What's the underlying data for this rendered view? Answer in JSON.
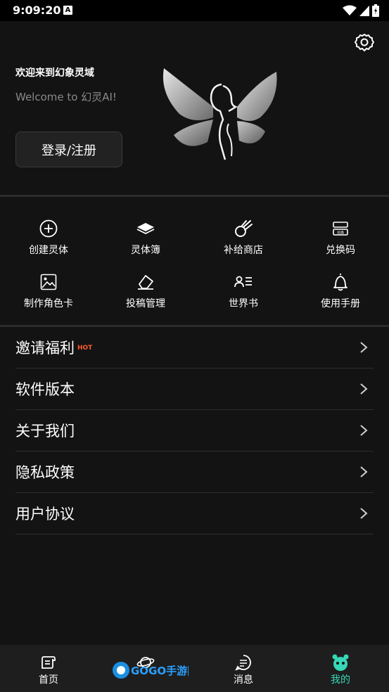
{
  "status_bar": {
    "time": "9:09:20",
    "notification_icon": "A"
  },
  "header": {
    "welcome_title": "欢迎来到幻象灵域",
    "welcome_subtitle": "Welcome to 幻灵AI!",
    "login_label": "登录/注册"
  },
  "grid": [
    {
      "label": "创建灵体",
      "icon": "plus-circle-icon"
    },
    {
      "label": "灵体簿",
      "icon": "book-icon"
    },
    {
      "label": "补给商店",
      "icon": "meteor-icon"
    },
    {
      "label": "兑换码",
      "icon": "ticket-icon"
    },
    {
      "label": "制作角色卡",
      "icon": "image-icon"
    },
    {
      "label": "投稿管理",
      "icon": "eraser-icon"
    },
    {
      "label": "世界书",
      "icon": "person-list-icon"
    },
    {
      "label": "使用手册",
      "icon": "bell-icon"
    }
  ],
  "ticket_icon_text": "兑换",
  "list": [
    {
      "label": "邀请福利",
      "badge": "HOT"
    },
    {
      "label": "软件版本"
    },
    {
      "label": "关于我们"
    },
    {
      "label": "隐私政策"
    },
    {
      "label": "用户协议"
    }
  ],
  "bottom_nav": [
    {
      "label": "首页",
      "icon": "home-scroll-icon"
    },
    {
      "label": "",
      "icon": "planet-icon"
    },
    {
      "label": "消息",
      "icon": "message-icon"
    },
    {
      "label": "我的",
      "icon": "mine-face-icon",
      "active": true
    }
  ],
  "watermark": {
    "text": "GOGO手游网"
  },
  "colors": {
    "accent": "#37d7b7",
    "hot": "#ff5a2c",
    "background": "#131313"
  }
}
